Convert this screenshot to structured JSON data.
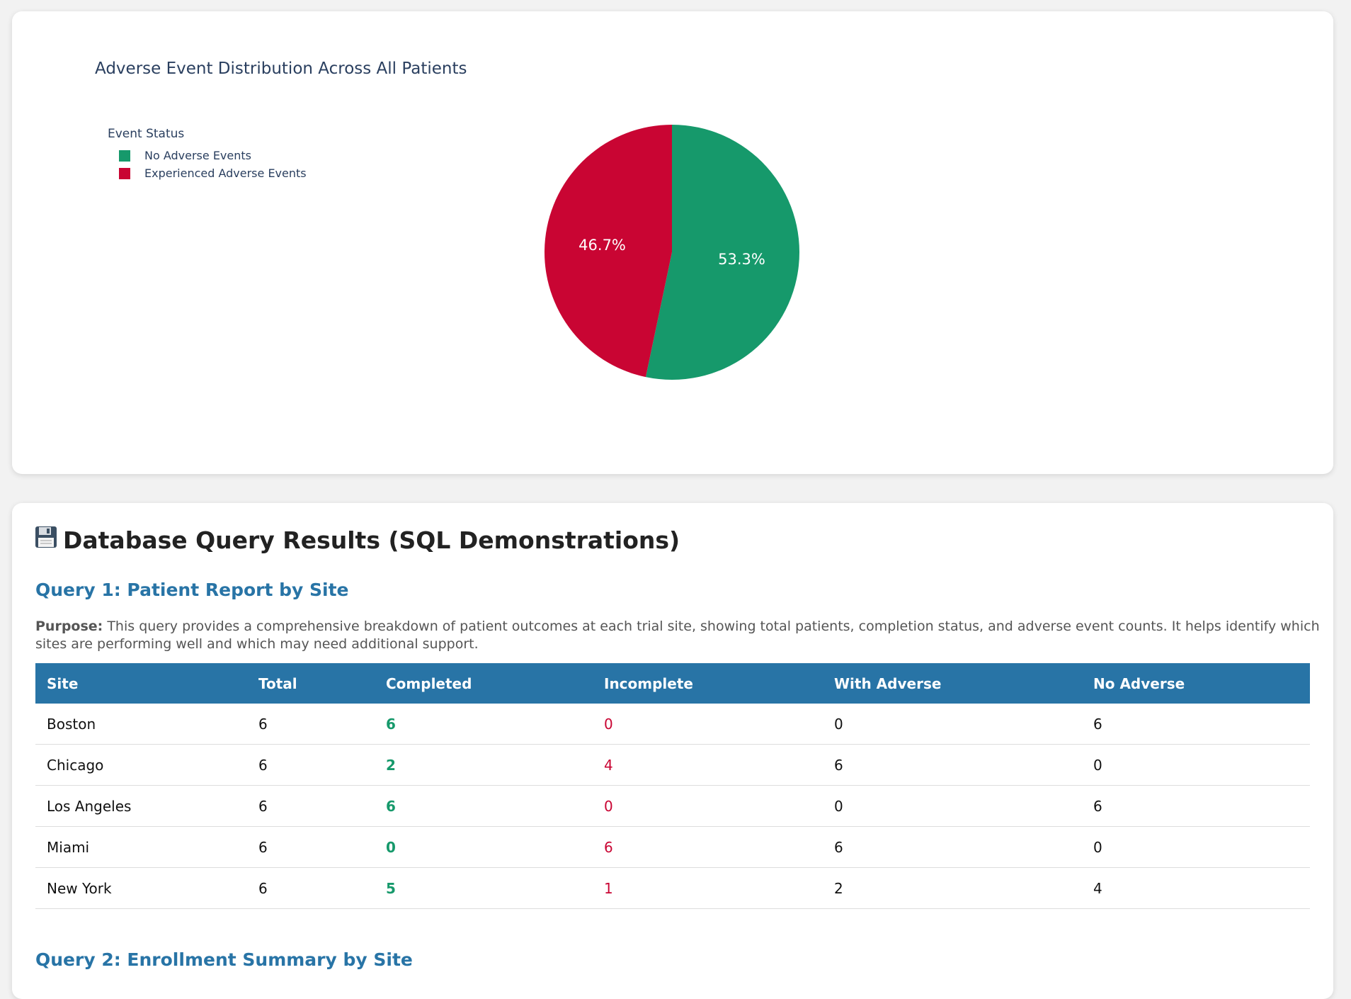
{
  "chart_data": {
    "type": "pie",
    "title": "Adverse Event Distribution Across All Patients",
    "legend_title": "Event Status",
    "legend_position": "top-left",
    "slices": [
      {
        "label": "No Adverse Events",
        "value": 53.3,
        "display": "53.3%",
        "color": "#16996b"
      },
      {
        "label": "Experienced Adverse Events",
        "value": 46.7,
        "display": "46.7%",
        "color": "#c90533"
      }
    ]
  },
  "db_section": {
    "icon": "floppy-disk-icon",
    "title": "Database Query Results (SQL Demonstrations)",
    "query1": {
      "title": "Query 1: Patient Report by Site",
      "purpose_label": "Purpose:",
      "purpose_text": "This query provides a comprehensive breakdown of patient outcomes at each trial site, showing total patients, completion status, and adverse event counts. It helps identify which sites are performing well and which may need additional support.",
      "headers": [
        "Site",
        "Total",
        "Completed",
        "Incomplete",
        "With Adverse",
        "No Adverse"
      ],
      "rows": [
        [
          "Boston",
          "6",
          "6",
          "0",
          "0",
          "6"
        ],
        [
          "Chicago",
          "6",
          "2",
          "4",
          "6",
          "0"
        ],
        [
          "Los Angeles",
          "6",
          "6",
          "0",
          "0",
          "6"
        ],
        [
          "Miami",
          "6",
          "0",
          "6",
          "6",
          "0"
        ],
        [
          "New York",
          "6",
          "5",
          "1",
          "2",
          "4"
        ]
      ]
    },
    "query2": {
      "title": "Query 2: Enrollment Summary by Site"
    }
  },
  "colors": {
    "accent_blue": "#2874a6",
    "positive_green": "#16996b",
    "negative_red": "#c90533"
  }
}
